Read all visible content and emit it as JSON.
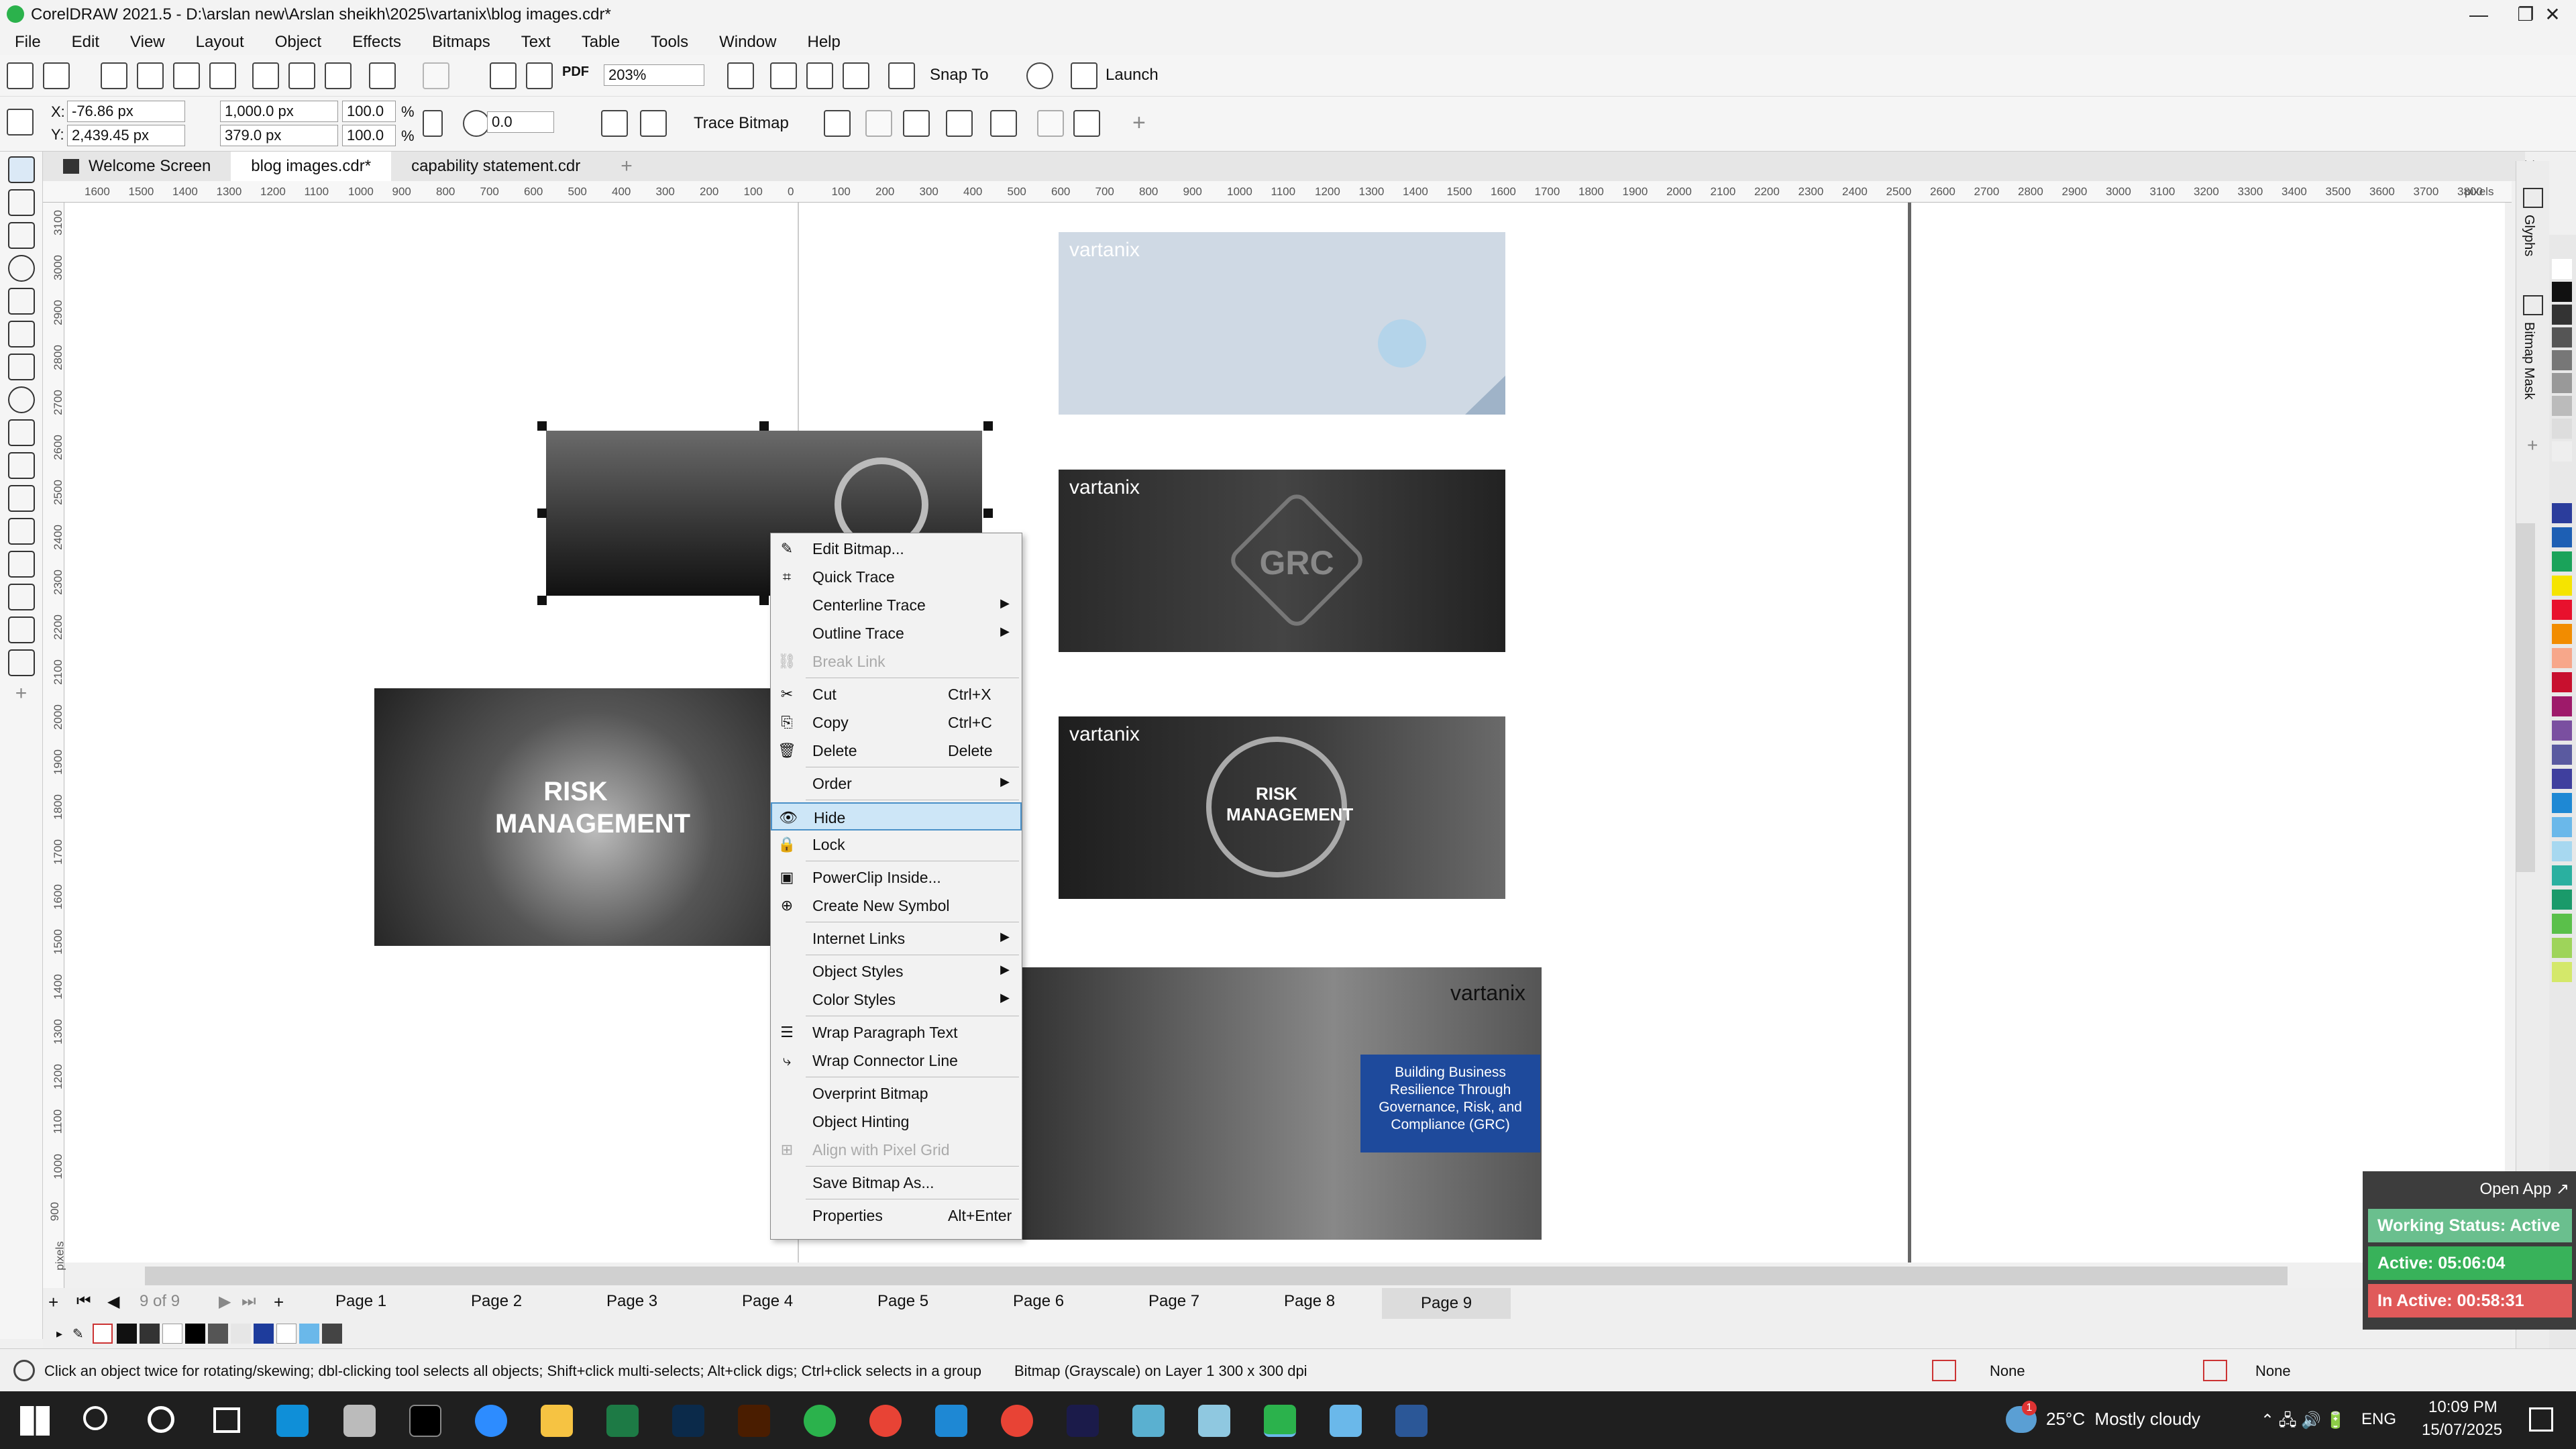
{
  "window": {
    "title": "CorelDRAW 2021.5 - D:\\arslan new\\Arslan sheikh\\2025\\vartanix\\blog images.cdr*",
    "minimize": "—",
    "maximize": "❐",
    "close": "✕"
  },
  "menu": [
    "File",
    "Edit",
    "View",
    "Layout",
    "Object",
    "Effects",
    "Bitmaps",
    "Text",
    "Table",
    "Tools",
    "Window",
    "Help"
  ],
  "toolbar": {
    "zoom": "203%",
    "snap_to": "Snap To",
    "launch": "Launch",
    "pdf": "PDF"
  },
  "properties": {
    "x": "-76.86 px",
    "y": "2,439.45 px",
    "width": "1,000.0 px",
    "height": "379.0 px",
    "scale_w": "100.0",
    "scale_h": "100.0",
    "percent": "%",
    "rotation": "0.0",
    "trace_bitmap": "Trace Bitmap"
  },
  "doc_tabs": [
    "Welcome Screen",
    "blog images.cdr*",
    "capability statement.cdr"
  ],
  "ruler_h": [
    "1600",
    "1500",
    "1400",
    "1300",
    "1200",
    "1100",
    "1000",
    "900",
    "800",
    "700",
    "600",
    "500",
    "400",
    "300",
    "200",
    "100",
    "0",
    "100",
    "200",
    "300",
    "400",
    "500",
    "600",
    "700",
    "800",
    "900",
    "1000",
    "1100",
    "1200",
    "1300",
    "1400",
    "1500",
    "1600",
    "1700",
    "1800",
    "1900",
    "2000",
    "2100",
    "2200",
    "2300",
    "2400",
    "2500",
    "2600",
    "2700",
    "2800",
    "2900",
    "3000",
    "3100",
    "3200",
    "3300",
    "3400",
    "3500",
    "3600",
    "3700",
    "3800",
    "pixels"
  ],
  "ruler_v": [
    "3100",
    "3000",
    "2900",
    "2800",
    "2700",
    "2600",
    "2500",
    "2400",
    "2300",
    "2200",
    "2100",
    "2000",
    "1900",
    "1800",
    "1700",
    "1600",
    "1500",
    "1400",
    "1300",
    "1200",
    "1100",
    "1000",
    "900",
    "pixels"
  ],
  "canvas": {
    "brand": "vartanix",
    "grc_text": "GRC",
    "risk_text": "RISK MANAGEMENT",
    "risk_small": "RISK MANAGEMENT",
    "banner_text": "Building Business Resilience Through Governance, Risk, and Compliance (GRC)"
  },
  "context_menu": [
    {
      "label": "Edit Bitmap...",
      "icon": "edit-bitmap-icon",
      "glyph": "✎"
    },
    {
      "label": "Quick Trace",
      "icon": "quick-trace-icon",
      "glyph": "⌗"
    },
    {
      "label": "Centerline Trace",
      "arrow": true
    },
    {
      "label": "Outline Trace",
      "arrow": true
    },
    {
      "label": "Break Link",
      "disabled": true,
      "icon": "break-link-icon",
      "glyph": "⛓"
    },
    {
      "sep": true
    },
    {
      "label": "Cut",
      "shortcut": "Ctrl+X",
      "icon": "cut-icon",
      "glyph": "✂"
    },
    {
      "label": "Copy",
      "shortcut": "Ctrl+C",
      "icon": "copy-icon",
      "glyph": "⎘"
    },
    {
      "label": "Delete",
      "shortcut": "Delete",
      "icon": "delete-icon",
      "glyph": "🗑"
    },
    {
      "sep": true
    },
    {
      "label": "Order",
      "arrow": true
    },
    {
      "sep": true
    },
    {
      "label": "Hide",
      "highlighted": true,
      "icon": "hide-eye-icon",
      "glyph": "👁"
    },
    {
      "label": "Lock",
      "icon": "lock-icon",
      "glyph": "🔒"
    },
    {
      "sep": true
    },
    {
      "label": "PowerClip Inside...",
      "icon": "powerclip-icon",
      "glyph": "▣"
    },
    {
      "label": "Create New Symbol",
      "icon": "symbol-icon",
      "glyph": "⊕"
    },
    {
      "sep": true
    },
    {
      "label": "Internet Links",
      "arrow": true
    },
    {
      "sep": true
    },
    {
      "label": "Object Styles",
      "arrow": true
    },
    {
      "label": "Color Styles",
      "arrow": true
    },
    {
      "sep": true
    },
    {
      "label": "Wrap Paragraph Text",
      "icon": "wrap-text-icon",
      "glyph": "☰"
    },
    {
      "label": "Wrap Connector Line",
      "icon": "wrap-connector-icon",
      "glyph": "⤷"
    },
    {
      "sep": true
    },
    {
      "label": "Overprint Bitmap"
    },
    {
      "label": "Object Hinting"
    },
    {
      "label": "Align with Pixel Grid",
      "disabled": true,
      "icon": "pixel-grid-icon",
      "glyph": "⊞"
    },
    {
      "sep": true
    },
    {
      "label": "Save Bitmap As..."
    },
    {
      "sep": true
    },
    {
      "label": "Properties",
      "shortcut": "Alt+Enter"
    }
  ],
  "pages": {
    "counter": "9 of 9",
    "tabs": [
      "Page 1",
      "Page 2",
      "Page 3",
      "Page 4",
      "Page 5",
      "Page 6",
      "Page 7",
      "Page 8",
      "Page 9"
    ],
    "active": "Page 9"
  },
  "status": {
    "hint": "Click an object twice for rotating/skewing; dbl-clicking tool selects all objects; Shift+click multi-selects; Alt+click digs; Ctrl+click selects in a group",
    "object_info": "Bitmap (Grayscale) on Layer 1 300 x 300 dpi",
    "fill": "None",
    "outline": "None"
  },
  "dockers": {
    "glyphs": "Glyphs",
    "bitmap_mask": "Bitmap Mask"
  },
  "widget": {
    "open_app": "Open App ↗",
    "working_status": "Working Status: Active",
    "active": "Active: 05:06:04",
    "inactive": "In Active: 00:58:31"
  },
  "taskbar": {
    "weather": "25°C  Mostly cloudy",
    "lang": "ENG",
    "time": "10:09 PM",
    "date": "15/07/2025",
    "badge": "1"
  },
  "colors": {
    "accent": "#2bb24c",
    "highlight": "#cde6f7",
    "working": "#6abf8e",
    "active": "#38b25a",
    "inactive": "#e05a5a",
    "banner": "#1e4a9c"
  }
}
